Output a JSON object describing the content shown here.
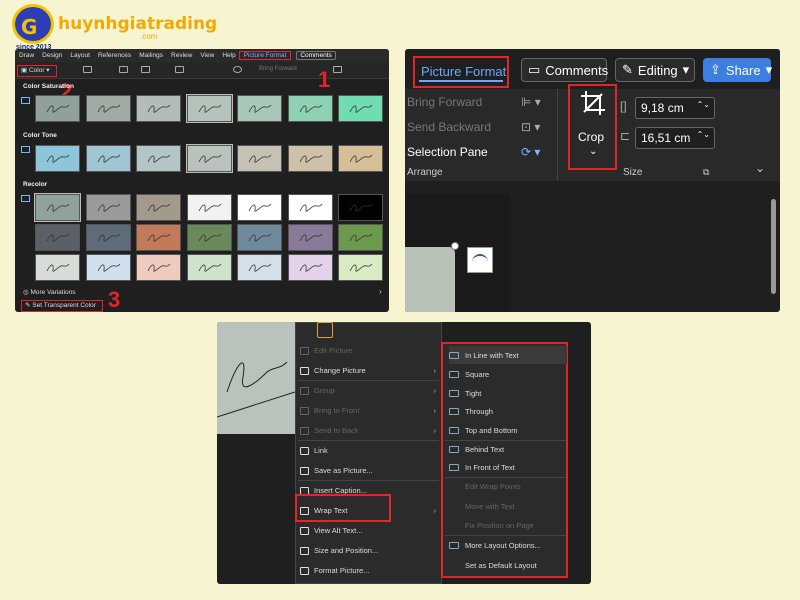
{
  "logo": {
    "text": "huynhgiatrading",
    "com": ".com",
    "since": "since 2013",
    "mark": "G"
  },
  "panel1": {
    "menu": [
      "Draw",
      "Design",
      "Layout",
      "References",
      "Mailings",
      "Review",
      "View",
      "Help"
    ],
    "active_tab": "Picture Format",
    "comments": "Comments",
    "color_button": "Color",
    "bring_forward": "Bring Forward",
    "sections": {
      "saturation": "Color Saturation",
      "tone": "Color Tone",
      "recolor": "Recolor"
    },
    "more_variations": "More Variations",
    "set_transparent": "Set Transparent Color",
    "step_numbers": [
      "1",
      "2",
      "3"
    ],
    "saturation_colors": [
      "#8fa19a",
      "#a2aaa6",
      "#b3bcb8",
      "#b6c3bd",
      "#a9c7b9",
      "#8dd2b5",
      "#6fdcb1"
    ],
    "tone_colors": [
      "#8dc6da",
      "#9fc6d2",
      "#b3c5c7",
      "#b9c2bc",
      "#c5c2b5",
      "#cfc1a7",
      "#d5bf97"
    ],
    "recolor_colors": [
      [
        "#8fa39c",
        "#9b9b9b",
        "#a39a8c",
        "#f2f2f2",
        "#ffffff",
        "#ffffff",
        "#000000"
      ],
      [
        "#5a6066",
        "#5d6b7a",
        "#c27a5a",
        "#6b8a5c",
        "#6f8a9c",
        "#8a7a9a",
        "#6c9a4c"
      ],
      [
        "#d8dcd9",
        "#cfe0ec",
        "#f0cbc0",
        "#cfe3cb",
        "#d3e0e8",
        "#e3d2ea",
        "#d8ecc4"
      ]
    ]
  },
  "panel2": {
    "tab": "Picture Format",
    "comments": "Comments",
    "editing": "Editing",
    "share": "Share",
    "arrange_items": [
      "Bring Forward",
      "Send Backward",
      "Selection Pane"
    ],
    "arrange_label": "Arrange",
    "crop": "Crop",
    "height": "9,18 cm",
    "width": "16,51 cm",
    "size_label": "Size"
  },
  "panel3": {
    "menu": [
      {
        "label": "Edit Picture",
        "disabled": true
      },
      {
        "label": "Change Picture",
        "disabled": false,
        "sub": true
      },
      {
        "label": "Group",
        "disabled": true,
        "sub": true
      },
      {
        "label": "Bring to Front",
        "disabled": true,
        "sub": true
      },
      {
        "label": "Send to Back",
        "disabled": true,
        "sub": true
      },
      {
        "label": "Link",
        "disabled": false
      },
      {
        "label": "Save as Picture...",
        "disabled": false
      },
      {
        "label": "Insert Caption...",
        "disabled": false
      },
      {
        "label": "Wrap Text",
        "disabled": false,
        "sub": true
      },
      {
        "label": "View Alt Text...",
        "disabled": false
      },
      {
        "label": "Size and Position...",
        "disabled": false
      },
      {
        "label": "Format Picture...",
        "disabled": false
      }
    ],
    "submenu": [
      {
        "label": "In Line with Text",
        "disabled": false
      },
      {
        "label": "Square",
        "disabled": false
      },
      {
        "label": "Tight",
        "disabled": false
      },
      {
        "label": "Through",
        "disabled": false
      },
      {
        "label": "Top and Bottom",
        "disabled": false
      },
      {
        "label": "Behind Text",
        "disabled": false
      },
      {
        "label": "In Front of Text",
        "disabled": false
      },
      {
        "label": "Edit Wrap Points",
        "disabled": true
      },
      {
        "label": "Move with Text",
        "disabled": true
      },
      {
        "label": "Fix Position on Page",
        "disabled": true
      },
      {
        "label": "More Layout Options...",
        "disabled": false
      },
      {
        "label": "Set as Default Layout",
        "disabled": false
      }
    ]
  }
}
